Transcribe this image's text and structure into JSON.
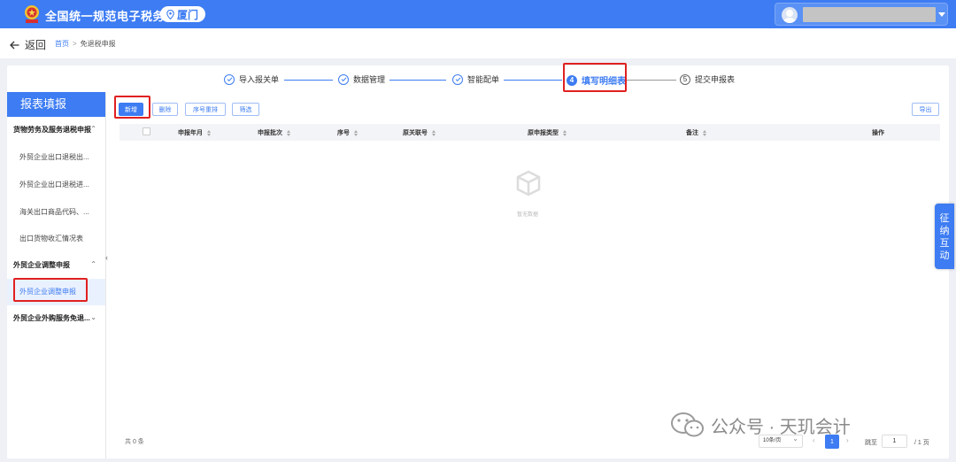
{
  "header": {
    "title": "全国统一规范电子税务局",
    "region": "厦门"
  },
  "breadcrumb": {
    "back_label": "返回",
    "home": "首页",
    "separator": ">",
    "current": "免退税申报"
  },
  "steps": [
    {
      "label": "导入报关单",
      "state": "done"
    },
    {
      "label": "数据管理",
      "state": "done"
    },
    {
      "label": "智能配单",
      "state": "done"
    },
    {
      "label": "填写明细表",
      "state": "active",
      "num": "4"
    },
    {
      "label": "提交申报表",
      "state": "todo",
      "num": "5"
    }
  ],
  "sidebar": {
    "title": "报表填报",
    "groups": [
      {
        "label": "货物劳务及服务退税申报",
        "expanded": true,
        "items": [
          "外贸企业出口退税出...",
          "外贸企业出口退税进...",
          "海关出口商品代码、...",
          "出口货物收汇情况表"
        ]
      },
      {
        "label": "外贸企业调整申报",
        "expanded": true,
        "items": [
          "外贸企业调整申报"
        ]
      },
      {
        "label": "外贸企业外购服务免退...",
        "expanded": false,
        "items": []
      }
    ],
    "collapse_glyph": "‹"
  },
  "toolbar": {
    "add": "新增",
    "delete": "删除",
    "renumber": "序号重排",
    "filter": "筛选",
    "export": "导出"
  },
  "table": {
    "columns": [
      "申报年月",
      "申报批次",
      "序号",
      "原关联号",
      "原申报类型",
      "备注",
      "操作"
    ],
    "empty_text": "暂无数据"
  },
  "pager": {
    "total": "共 0 条",
    "page_size": "10条/页",
    "prev": "‹",
    "next": "›",
    "current": "1",
    "jump_label": "跳至",
    "jump_value": "1",
    "total_pages": "/ 1 页"
  },
  "float_tab": [
    "征",
    "纳",
    "互",
    "动"
  ],
  "watermark": "公众号 · 天玑会计",
  "colors": {
    "primary": "#3d7cf2",
    "highlight": "#e02020"
  }
}
